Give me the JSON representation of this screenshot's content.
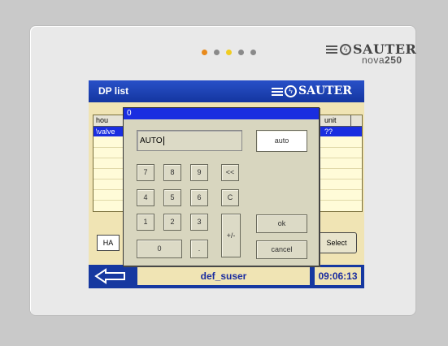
{
  "device": {
    "led_colors": [
      "#e88a1c",
      "#8a8a8a",
      "#f0cc22",
      "#8a8a8a",
      "#8a8a8a"
    ],
    "brand": {
      "name": "SAUTER",
      "model_prefix": "nova",
      "model_number": "250",
      "logo_icon": "sauter-logo-icon"
    }
  },
  "screen": {
    "title": "DP list",
    "brand_name": "SAUTER",
    "table": {
      "headers": [
        "hou",
        "unit"
      ],
      "rows": [
        {
          "first_cell": "\\valve",
          "unit": "??"
        }
      ]
    },
    "ha_label": "HA",
    "select_label": "Select",
    "back_icon": "left-arrow-icon",
    "user": "def_suser",
    "time": "09:06:13"
  },
  "dialog": {
    "title": "0",
    "display_value": "AUTO",
    "auto_label": "auto",
    "keys": {
      "k7": "7",
      "k8": "8",
      "k9": "9",
      "backspace": "<<",
      "k4": "4",
      "k5": "5",
      "k6": "6",
      "clear": "C",
      "k1": "1",
      "k2": "2",
      "k3": "3",
      "plus_minus": "+/-",
      "k0": "0",
      "dot": "."
    },
    "ok_label": "ok",
    "cancel_label": "cancel"
  },
  "colors": {
    "accent": "#1638a0",
    "selection": "#1a2ee0",
    "panel": "#f0e4b4"
  }
}
